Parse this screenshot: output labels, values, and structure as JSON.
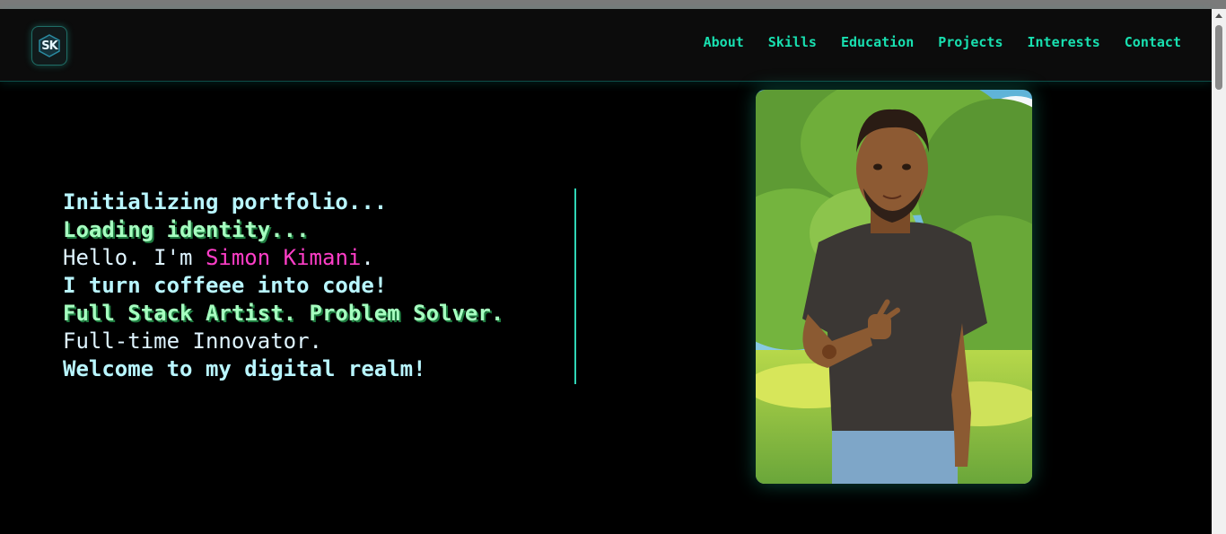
{
  "nav": {
    "logo_text": "SK",
    "links": [
      "About",
      "Skills",
      "Education",
      "Projects",
      "Interests",
      "Contact"
    ]
  },
  "hero": {
    "lines": [
      "Initializing portfolio...",
      "Loading identity...",
      "Hello. I'm ",
      "I turn coffeee into code!",
      "Full Stack Artist. Problem Solver.",
      "Full-time Innovator.",
      "Welcome to my digital realm!"
    ],
    "name": "Simon Kimani",
    "name_suffix": "."
  },
  "colors": {
    "accent": "#18e0b0",
    "name_highlight": "#ff3ec8",
    "background": "#000000"
  },
  "icons": {
    "logo": "sk-hexagon-logo"
  }
}
